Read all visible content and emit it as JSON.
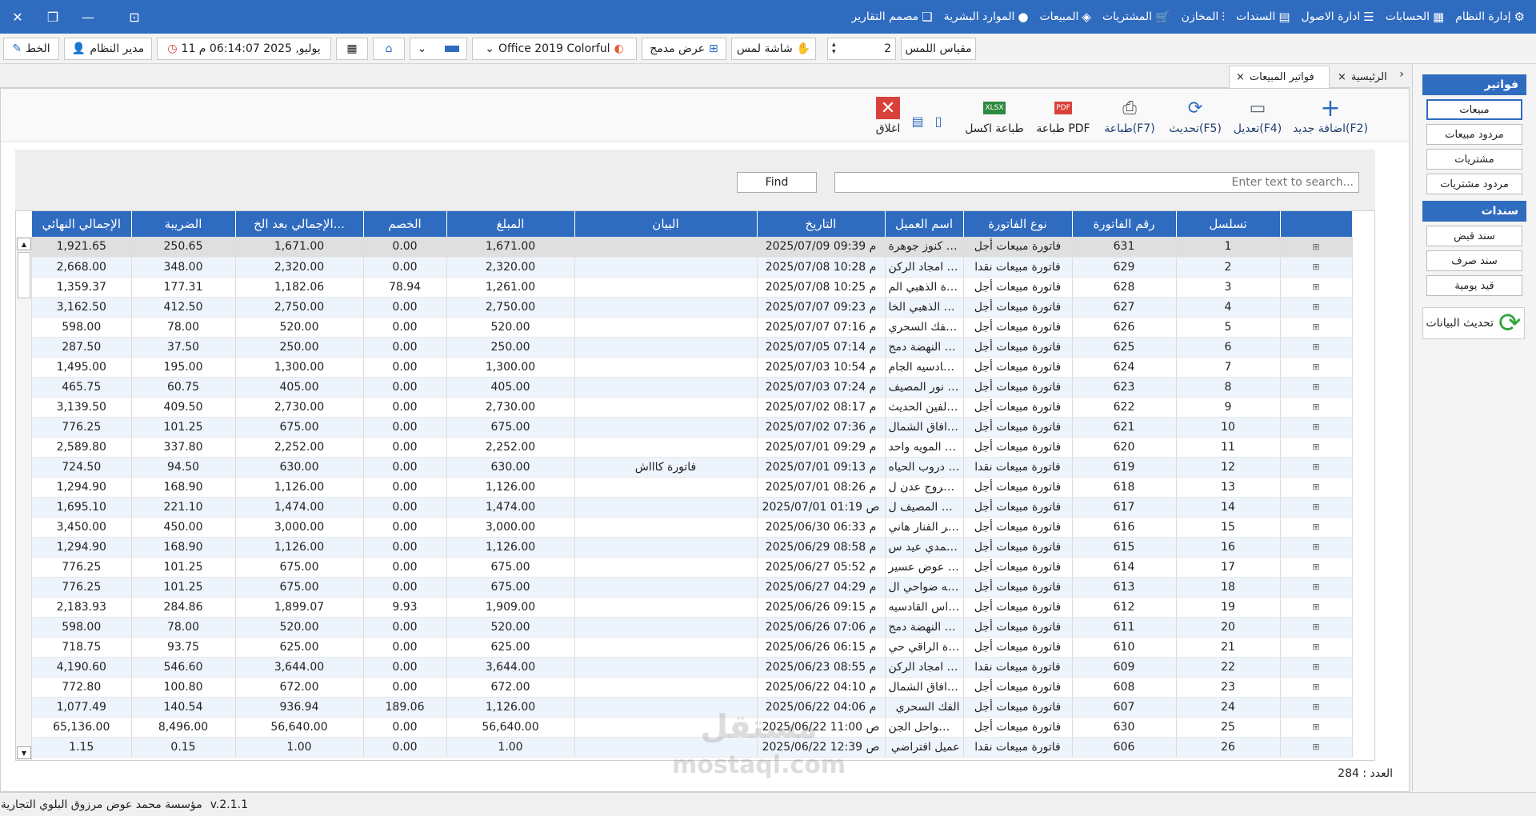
{
  "menubar": {
    "items": [
      {
        "label": "إدارة النظام",
        "icon": "gear-icon"
      },
      {
        "label": "الحسابات",
        "icon": "calculator-icon"
      },
      {
        "label": "ادارة الاصول",
        "icon": "list-icon"
      },
      {
        "label": "السندات",
        "icon": "document-icon"
      },
      {
        "label": "المخازن",
        "icon": "sliders-icon"
      },
      {
        "label": "المشتريات",
        "icon": "cart-icon"
      },
      {
        "label": "المبيعات",
        "icon": "tag-icon"
      },
      {
        "label": "الموارد البشرية",
        "icon": "user-icon"
      },
      {
        "label": "مصمم التقارير",
        "icon": "report-icon"
      }
    ]
  },
  "toolbar": {
    "touch_size_label": "مقياس اللمس",
    "touch_size_value": "2",
    "touch_screen_label": "شاشة لمس",
    "compact_view_label": "عرض مدمج",
    "theme_value": "Office 2019 Colorful",
    "datetime": "11 يوليو, 2025 06:14:07 م",
    "user_label": "مدير النظام",
    "font_label": "الخط"
  },
  "tabs": [
    {
      "label": "الرئيسية"
    },
    {
      "label": "فواتير المبيعات"
    }
  ],
  "ribbon": {
    "add_label": "اضافة جديد(F2)",
    "edit_label": "تعديل(F4)",
    "refresh_label": "تحديث(F5)",
    "print_label": "طباعة(F7)",
    "pdf_label": "طباعة PDF",
    "excel_label": "طباعة اكسل",
    "close_label": "اغلاق",
    "pdf_badge": "PDF",
    "excel_badge": "XLSX"
  },
  "search": {
    "placeholder": "Enter text to search...",
    "find_label": "Find"
  },
  "grid": {
    "columns": [
      "تسلسل",
      "رقم الفاتورة",
      "نوع الفاتورة",
      "اسم العميل",
      "التاريخ",
      "البيان",
      "المبلغ",
      "الخصم",
      "الإجمالي بعد الخ...",
      "الضريبة",
      "الإجمالي النهائي"
    ],
    "rows": [
      [
        "1",
        "631",
        "فاتورة مبيعات أجل",
        "شركة كنوز جوهرة ...",
        "2025/07/09 09:39 م",
        "",
        "1,671.00",
        "0.00",
        "1,671.00",
        "250.65",
        "1,921.65"
      ],
      [
        "2",
        "629",
        "فاتورة مبيعات نقدا",
        "شركة امجاد الركن ...",
        "2025/07/08 10:28 م",
        "",
        "2,320.00",
        "0.00",
        "2,320.00",
        "348.00",
        "2,668.00"
      ],
      [
        "3",
        "628",
        "فاتورة مبيعات أجل",
        "الجودة الذهبي الم...",
        "2025/07/08 10:25 م",
        "",
        "1,261.00",
        "78.94",
        "1,182.06",
        "177.31",
        "1,359.37"
      ],
      [
        "4",
        "627",
        "فاتورة مبيعات أجل",
        "الفاحص الذهبي الخا...",
        "2025/07/07 09:23 م",
        "",
        "2,750.00",
        "0.00",
        "2,750.00",
        "412.50",
        "3,162.50"
      ],
      [
        "5",
        "626",
        "فاتورة مبيعات أجل",
        "بنشر الفك السحري...",
        "2025/07/07 07:16 م",
        "",
        "520.00",
        "0.00",
        "520.00",
        "78.00",
        "598.00"
      ],
      [
        "6",
        "625",
        "فاتورة مبيعات أجل",
        "فجرة النهضة دمج",
        "2025/07/05 07:14 م",
        "",
        "250.00",
        "0.00",
        "250.00",
        "37.50",
        "287.50"
      ],
      [
        "7",
        "624",
        "فاتورة مبيعات أجل",
        "نبراس القادسيه الجام...",
        "2025/07/03 10:54 م",
        "",
        "1,300.00",
        "0.00",
        "1,300.00",
        "195.00",
        "1,495.00"
      ],
      [
        "8",
        "623",
        "فاتورة مبيعات أجل",
        "بنشر نور المصيف",
        "2025/07/03 07:24 م",
        "",
        "405.00",
        "0.00",
        "405.00",
        "60.75",
        "465.75"
      ],
      [
        "9",
        "622",
        "فاتورة مبيعات أجل",
        "مركز الفين الحديث ...",
        "2025/07/02 08:17 م",
        "",
        "2,730.00",
        "0.00",
        "2,730.00",
        "409.50",
        "3,139.50"
      ],
      [
        "10",
        "621",
        "فاتورة مبيعات أجل",
        "شركة افاق الشمال",
        "2025/07/02 07:36 م",
        "",
        "675.00",
        "0.00",
        "675.00",
        "101.25",
        "776.25"
      ],
      [
        "11",
        "620",
        "فاتورة مبيعات أجل",
        "موسسة المويه واحد ...",
        "2025/07/01 09:29 م",
        "",
        "2,252.00",
        "0.00",
        "2,252.00",
        "337.80",
        "2,589.80"
      ],
      [
        "12",
        "619",
        "فاتورة مبيعات نقدا",
        "مركز دروب الحياه ...",
        "2025/07/01 09:13 م",
        "فاتورة كاااش",
        "630.00",
        "0.00",
        "630.00",
        "94.50",
        "724.50"
      ],
      [
        "13",
        "618",
        "فاتورة مبيعات أجل",
        "مركز مروج عدن ل...",
        "2025/07/01 08:26 م",
        "",
        "1,126.00",
        "0.00",
        "1,126.00",
        "168.90",
        "1,294.90"
      ],
      [
        "14",
        "617",
        "فاتورة مبيعات أجل",
        "بنشرقلب المصيف ل...",
        "2025/07/01 01:19 ص",
        "",
        "1,474.00",
        "0.00",
        "1,474.00",
        "221.10",
        "1,695.10"
      ],
      [
        "15",
        "616",
        "فاتورة مبيعات أجل",
        "بنشر الفنار هاني",
        "2025/06/30 06:33 م",
        "",
        "3,000.00",
        "0.00",
        "3,000.00",
        "450.00",
        "3,450.00"
      ],
      [
        "16",
        "615",
        "فاتورة مبيعات أجل",
        "مركز حمدي عيد س...",
        "2025/06/29 08:58 م",
        "",
        "1,126.00",
        "0.00",
        "1,126.00",
        "168.90",
        "1,294.90"
      ],
      [
        "17",
        "614",
        "فاتورة مبيعات أجل",
        "موسسه عوض عسير...",
        "2025/06/27 05:52 م",
        "",
        "675.00",
        "0.00",
        "675.00",
        "101.25",
        "776.25"
      ],
      [
        "18",
        "613",
        "فاتورة مبيعات أجل",
        "مؤسسه ضواحي ال...",
        "2025/06/27 04:29 م",
        "",
        "675.00",
        "0.00",
        "675.00",
        "101.25",
        "776.25"
      ],
      [
        "19",
        "612",
        "فاتورة مبيعات أجل",
        "بنشر نبراس القادسيه...",
        "2025/06/26 09:15 م",
        "",
        "1,909.00",
        "9.93",
        "1,899.07",
        "284.86",
        "2,183.93"
      ],
      [
        "20",
        "611",
        "فاتورة مبيعات أجل",
        "فجرة النهضة دمج",
        "2025/06/26 07:06 م",
        "",
        "520.00",
        "0.00",
        "520.00",
        "78.00",
        "598.00"
      ],
      [
        "21",
        "610",
        "فاتورة مبيعات أجل",
        "بنشر درة الراقي حي...",
        "2025/06/26 06:15 م",
        "",
        "625.00",
        "0.00",
        "625.00",
        "93.75",
        "718.75"
      ],
      [
        "22",
        "609",
        "فاتورة مبيعات نقدا",
        "شركة امجاد الركن ...",
        "2025/06/23 08:55 م",
        "",
        "3,644.00",
        "0.00",
        "3,644.00",
        "546.60",
        "4,190.60"
      ],
      [
        "23",
        "608",
        "فاتورة مبيعات أجل",
        "شركة افاق الشمال",
        "2025/06/22 04:10 م",
        "",
        "672.00",
        "0.00",
        "672.00",
        "100.80",
        "772.80"
      ],
      [
        "24",
        "607",
        "فاتورة مبيعات أجل",
        "الفك السحري",
        "2025/06/22 04:06 م",
        "",
        "1,126.00",
        "189.06",
        "936.94",
        "140.54",
        "1,077.49"
      ],
      [
        "25",
        "630",
        "فاتورة مبيعات أجل",
        "شركة السواحل الجن...",
        "2025/06/22 11:00 ص",
        "",
        "56,640.00",
        "0.00",
        "56,640.00",
        "8,496.00",
        "65,136.00"
      ],
      [
        "26",
        "606",
        "فاتورة مبيعات نقدا",
        "عميل افتراضي",
        "2025/06/22 12:39 ص",
        "",
        "1.00",
        "0.00",
        "1.00",
        "0.15",
        "1.15"
      ]
    ]
  },
  "count_label": "العدد : 284",
  "sidepanel": {
    "invoices_title": "فواتير",
    "invoice_items": [
      "مبيعات",
      "مردود مبيعات",
      "مشتريات",
      "مردود مشتريات"
    ],
    "vouchers_title": "سندات",
    "voucher_items": [
      "سند قبض",
      "سند صرف",
      "قيد يومية"
    ],
    "refresh_label": "تحديث البيانات"
  },
  "statusbar": {
    "company": "مؤسسة محمد عوض مرزوق البلوي التجارية",
    "version": "v.2.1.1"
  },
  "watermark": {
    "arabic": "مستقل",
    "latin": "mostaql.com"
  },
  "colors": {
    "accent": "#2f6bbf",
    "close_red": "#d9423a",
    "refresh_green": "#2fa43a"
  }
}
